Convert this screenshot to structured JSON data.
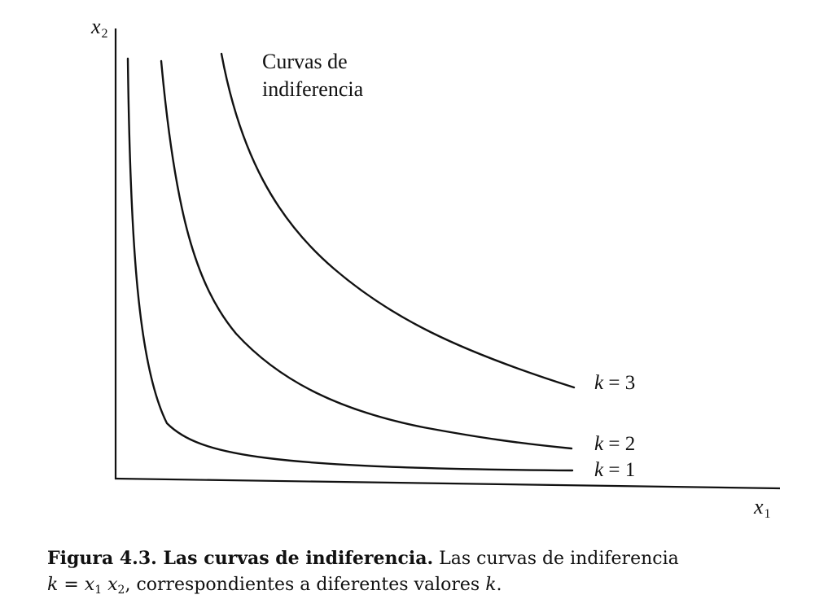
{
  "figure": {
    "annotation": {
      "line1": "Curvas de",
      "line2": "indiferencia"
    },
    "axes": {
      "y_label": {
        "var": "x",
        "sub": "2"
      },
      "x_label": {
        "var": "x",
        "sub": "1"
      }
    },
    "curves": [
      {
        "k_var": "k",
        "k_eq": " = 1",
        "k": 1
      },
      {
        "k_var": "k",
        "k_eq": " = 2",
        "k": 2
      },
      {
        "k_var": "k",
        "k_eq": " = 3",
        "k": 3
      }
    ]
  },
  "caption": {
    "bold": "Figura 4.3. Las curvas de indiferencia.",
    "rest_line1": " Las curvas de indiferencia",
    "formula_k": "k",
    "formula_eq": " = ",
    "formula_x1": "x",
    "formula_sub1": "1",
    "formula_x2": "x",
    "formula_sub2": "2",
    "rest_line2": ", correspondientes a diferentes valores ",
    "end_k": "k",
    "end_period": "."
  },
  "colors": {
    "ink": "#111111",
    "paper": "#ffffff"
  }
}
